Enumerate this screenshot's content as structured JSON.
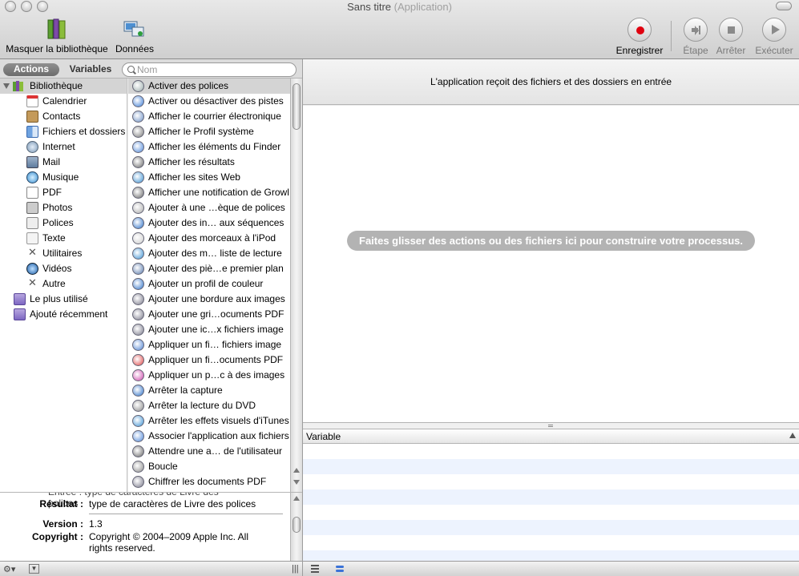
{
  "window": {
    "title": "Sans titre",
    "subtitle": "(Application)"
  },
  "toolbar": {
    "hide_library": "Masquer la bibliothèque",
    "data": "Données",
    "record": "Enregistrer",
    "step": "Étape",
    "stop": "Arrêter",
    "run": "Exécuter"
  },
  "tabs": {
    "actions": "Actions",
    "variables": "Variables"
  },
  "search": {
    "placeholder": "Nom"
  },
  "library": {
    "root": "Bibliothèque",
    "items": [
      {
        "label": "Calendrier",
        "icon": "calendar-icon"
      },
      {
        "label": "Contacts",
        "icon": "contacts-icon"
      },
      {
        "label": "Fichiers et dossiers",
        "icon": "finder-icon"
      },
      {
        "label": "Internet",
        "icon": "internet-icon"
      },
      {
        "label": "Mail",
        "icon": "mail-icon"
      },
      {
        "label": "Musique",
        "icon": "music-icon"
      },
      {
        "label": "PDF",
        "icon": "pdf-icon"
      },
      {
        "label": "Photos",
        "icon": "photos-icon"
      },
      {
        "label": "Polices",
        "icon": "fonts-icon"
      },
      {
        "label": "Texte",
        "icon": "text-icon"
      },
      {
        "label": "Utilitaires",
        "icon": "utilities-icon"
      },
      {
        "label": "Vidéos",
        "icon": "video-icon"
      },
      {
        "label": "Autre",
        "icon": "other-icon"
      }
    ],
    "smart_folders": [
      {
        "label": "Le plus utilisé",
        "icon": "smart-folder-icon"
      },
      {
        "label": "Ajouté récemment",
        "icon": "smart-folder-icon"
      }
    ]
  },
  "actions": [
    "Activer des polices",
    "Activer ou désactiver des pistes",
    "Afficher le courrier électronique",
    "Afficher le Profil système",
    "Afficher les éléments du Finder",
    "Afficher les résultats",
    "Afficher les sites Web",
    "Afficher une notification de Growl",
    "Ajouter à une …èque de polices",
    "Ajouter des in… aux séquences",
    "Ajouter des morceaux à l'iPod",
    "Ajouter des m… liste de lecture",
    "Ajouter des piè…e premier plan",
    "Ajouter un profil de couleur",
    "Ajouter une bordure aux images",
    "Ajouter une gri…ocuments PDF",
    "Ajouter une ic…x fichiers image",
    "Appliquer un fi… fichiers image",
    "Appliquer un fi…ocuments PDF",
    "Appliquer un p…c à des images",
    "Arrêter la capture",
    "Arrêter la lecture du DVD",
    "Arrêter les effets visuels d'iTunes",
    "Associer l'application aux fichiers",
    "Attendre une a… de l'utilisateur",
    "Boucle",
    "Chiffrer les documents PDF"
  ],
  "description": {
    "partial_line": "Entrée : type de caractères de Livre des polices",
    "result_label": "Résultat :",
    "result_value": "type de caractères de Livre des polices",
    "version_label": "Version :",
    "version_value": "1.3",
    "copyright_label": "Copyright :",
    "copyright_value": "Copyright © 2004–2009 Apple Inc. All rights reserved."
  },
  "workflow": {
    "header": "L'application reçoit des fichiers et des dossiers en entrée",
    "drop_hint": "Faites glisser des actions ou des fichiers ici pour construire votre processus."
  },
  "variables_table": {
    "column": "Variable"
  },
  "colors": {
    "record": "#e0000f",
    "drop_hint_bg": "#b3b3b3",
    "row_alt": "#edf3fe"
  }
}
